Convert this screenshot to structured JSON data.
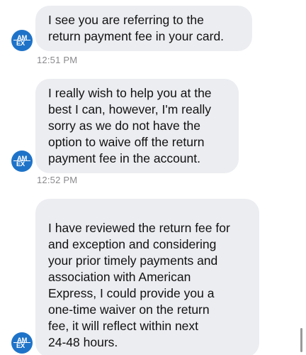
{
  "brand": {
    "avatar_line1": "AM",
    "avatar_line2": "EX",
    "avatar_color": "#1e73c8"
  },
  "colors": {
    "bubble_bg": "#ecedf1",
    "timestamp": "#8a8a8e",
    "text": "#111111"
  },
  "messages": [
    {
      "lines": [
        "I see you are referring to the",
        "return payment fee in your card."
      ],
      "time": "12:51 PM"
    },
    {
      "lines": [
        "I really wish to help you at the",
        "best I can, however, I'm really",
        "sorry as we do not have the",
        "option to waive off the return",
        "payment fee in the account."
      ],
      "time": "12:52 PM"
    },
    {
      "lines": [
        "I have reviewed the return fee for",
        "and exception and considering",
        "your prior timely payments and",
        "association with American",
        "Express, I could provide you a",
        "one-time waiver on the return",
        "fee, it will reflect within next",
        "24-48 hours."
      ],
      "time": ""
    }
  ]
}
